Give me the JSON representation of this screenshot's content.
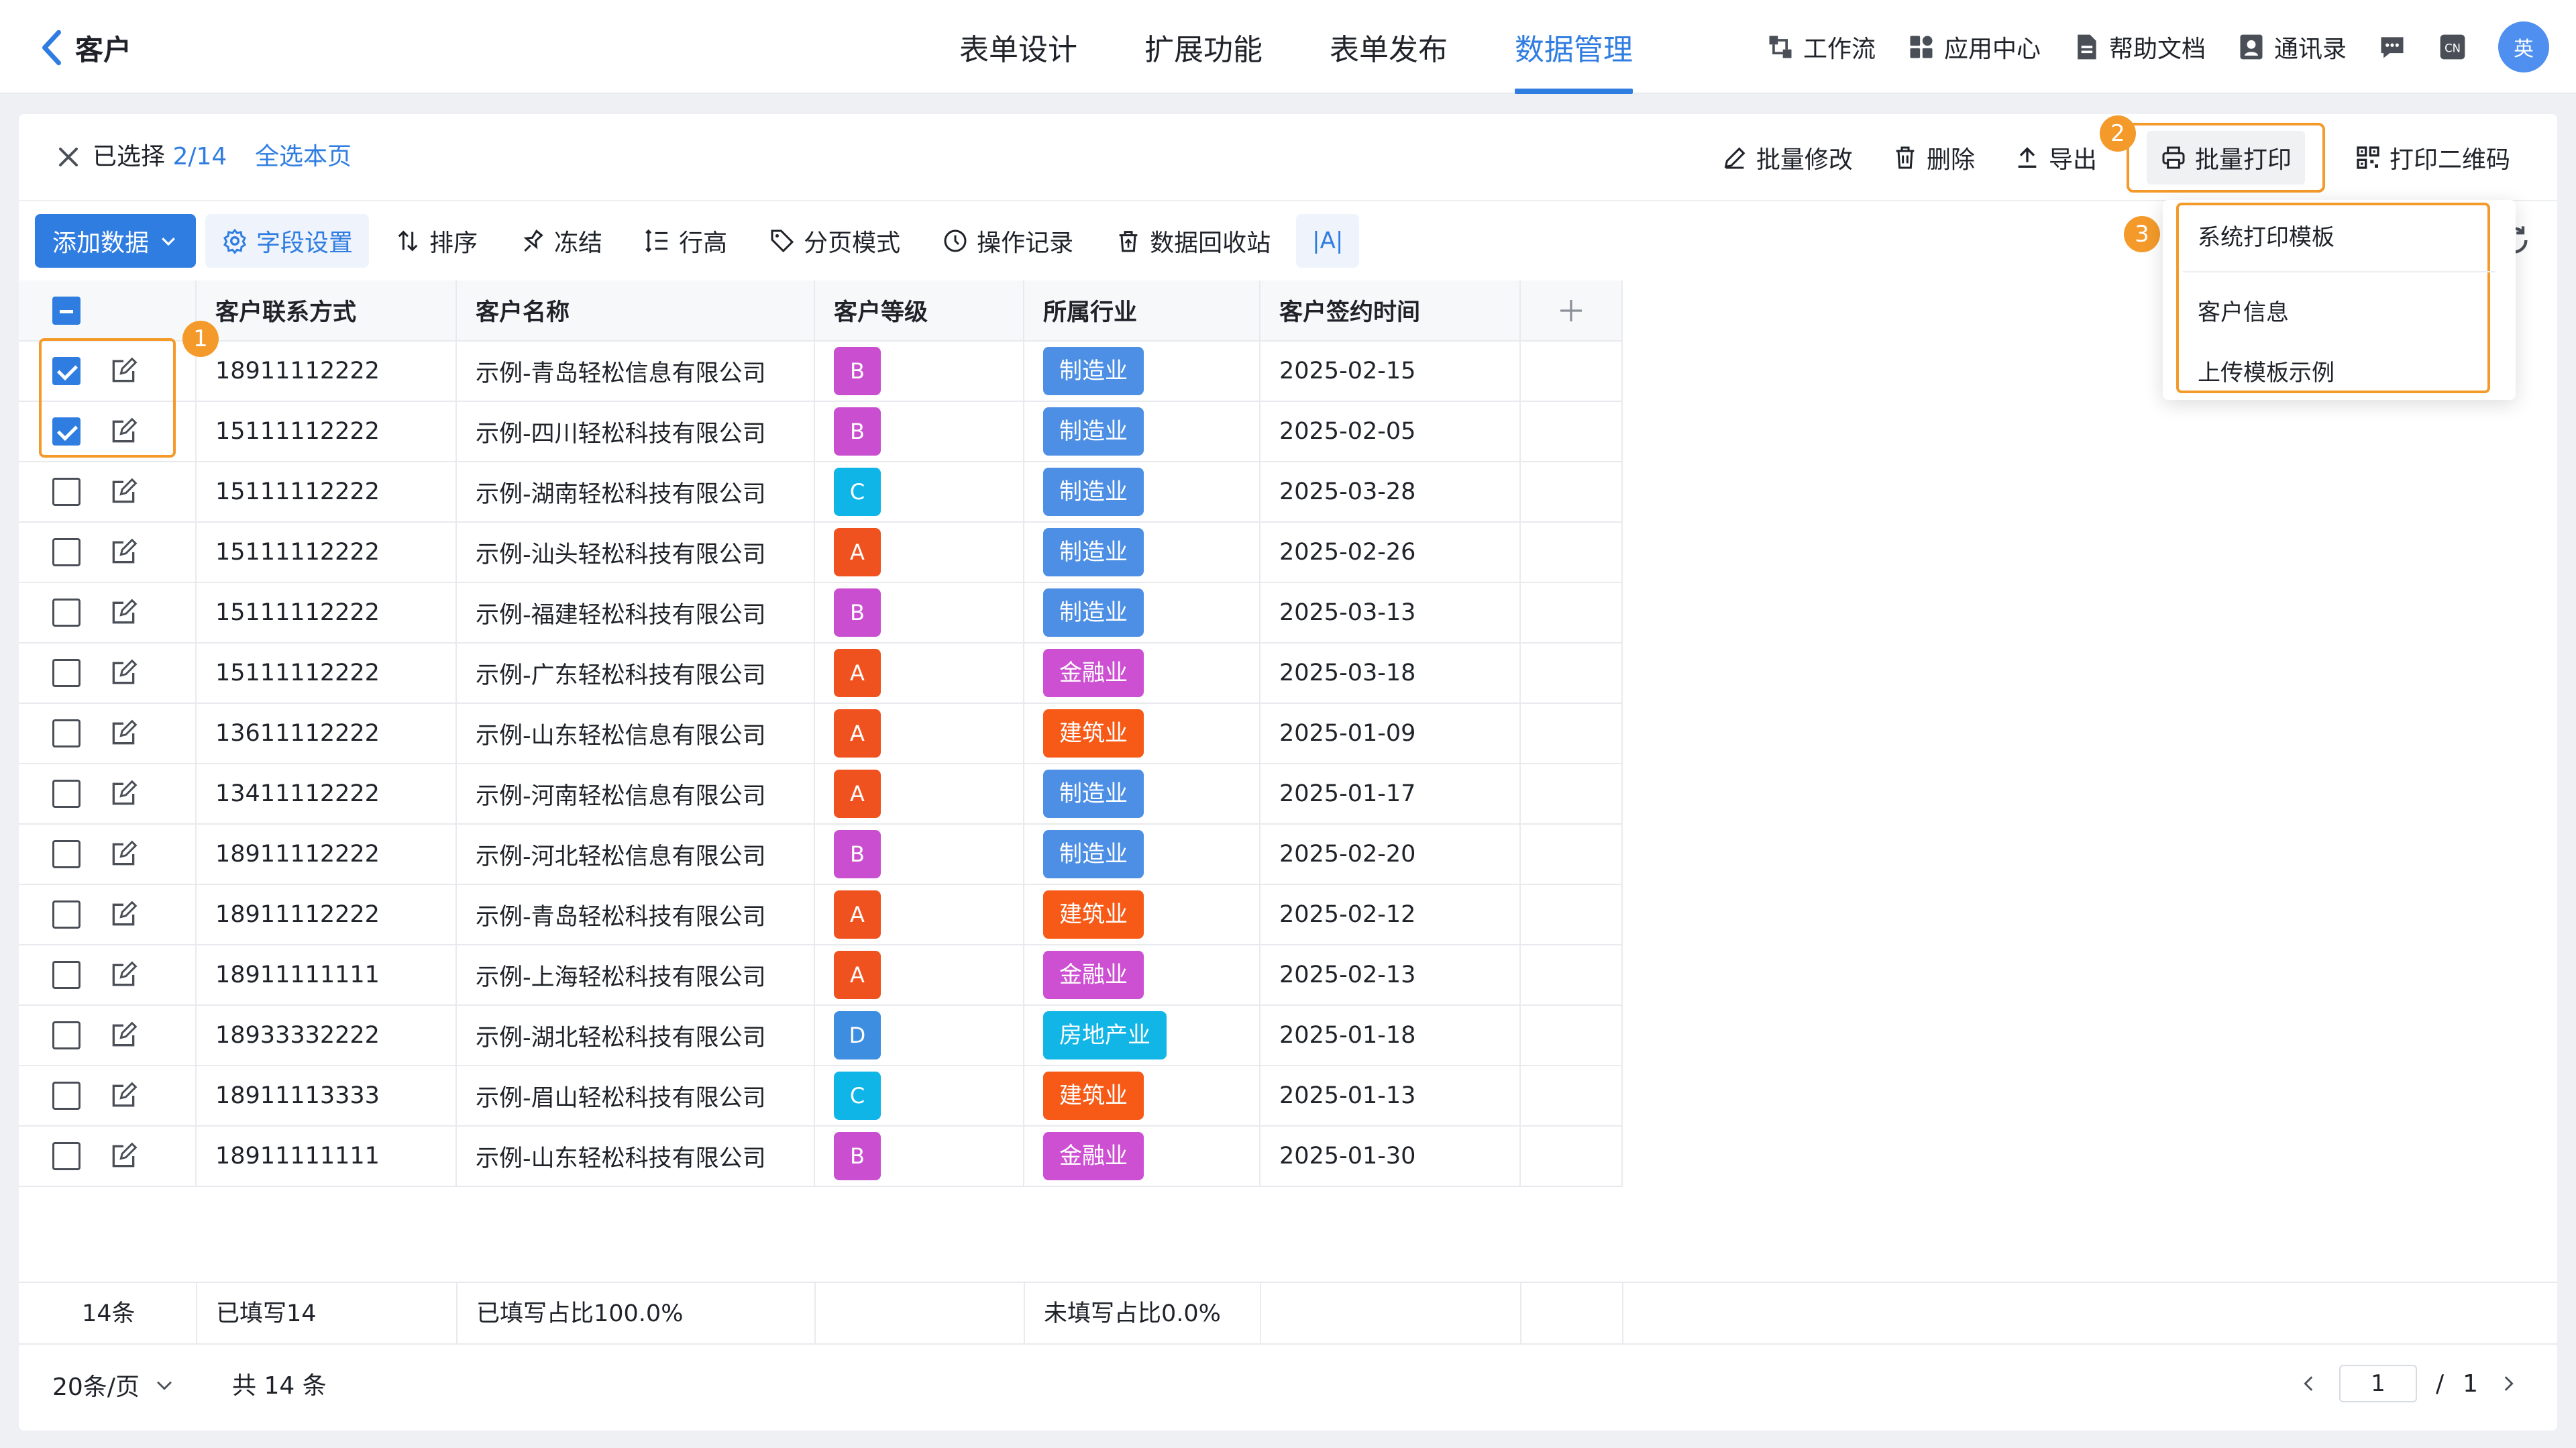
{
  "header": {
    "title": "客户",
    "tabs": [
      {
        "label": "表单设计"
      },
      {
        "label": "扩展功能"
      },
      {
        "label": "表单发布"
      },
      {
        "label": "数据管理"
      }
    ],
    "active_tab": "数据管理",
    "utils": {
      "workflow": "工作流",
      "app_center": "应用中心",
      "help_docs": "帮助文档",
      "contacts": "通讯录",
      "lang": "CN",
      "avatar": "英"
    }
  },
  "selection": {
    "prefix": "已选择 ",
    "count": "2/14",
    "select_page": "全选本页"
  },
  "actions": {
    "batch_edit": "批量修改",
    "delete": "删除",
    "export": "导出",
    "batch_print": "批量打印",
    "print_qr": "打印二维码"
  },
  "toolbar": {
    "add_data": "添加数据",
    "field_settings": "字段设置",
    "sort": "排序",
    "freeze": "冻结",
    "row_height": "行高",
    "page_mode": "分页模式",
    "op_log": "操作记录",
    "recycle": "数据回收站",
    "text_size": "|A|"
  },
  "print_menu": {
    "items": [
      "系统打印模板",
      "客户信息",
      "上传模板示例"
    ]
  },
  "markers": [
    "1",
    "2",
    "3"
  ],
  "table": {
    "columns": [
      "客户联系方式",
      "客户名称",
      "客户等级",
      "所属行业",
      "客户签约时间"
    ],
    "rows": [
      {
        "checked": true,
        "phone": "18911112222",
        "name": "示例-青岛轻松信息有限公司",
        "level": "B",
        "industry": "制造业",
        "date": "2025-02-15"
      },
      {
        "checked": true,
        "phone": "15111112222",
        "name": "示例-四川轻松科技有限公司",
        "level": "B",
        "industry": "制造业",
        "date": "2025-02-05"
      },
      {
        "checked": false,
        "phone": "15111112222",
        "name": "示例-湖南轻松科技有限公司",
        "level": "C",
        "industry": "制造业",
        "date": "2025-03-28"
      },
      {
        "checked": false,
        "phone": "15111112222",
        "name": "示例-汕头轻松科技有限公司",
        "level": "A",
        "industry": "制造业",
        "date": "2025-02-26"
      },
      {
        "checked": false,
        "phone": "15111112222",
        "name": "示例-福建轻松科技有限公司",
        "level": "B",
        "industry": "制造业",
        "date": "2025-03-13"
      },
      {
        "checked": false,
        "phone": "15111112222",
        "name": "示例-广东轻松科技有限公司",
        "level": "A",
        "industry": "金融业",
        "date": "2025-03-18"
      },
      {
        "checked": false,
        "phone": "13611112222",
        "name": "示例-山东轻松信息有限公司",
        "level": "A",
        "industry": "建筑业",
        "date": "2025-01-09"
      },
      {
        "checked": false,
        "phone": "13411112222",
        "name": "示例-河南轻松信息有限公司",
        "level": "A",
        "industry": "制造业",
        "date": "2025-01-17"
      },
      {
        "checked": false,
        "phone": "18911112222",
        "name": "示例-河北轻松信息有限公司",
        "level": "B",
        "industry": "制造业",
        "date": "2025-02-20"
      },
      {
        "checked": false,
        "phone": "18911112222",
        "name": "示例-青岛轻松科技有限公司",
        "level": "A",
        "industry": "建筑业",
        "date": "2025-02-12"
      },
      {
        "checked": false,
        "phone": "18911111111",
        "name": "示例-上海轻松科技有限公司",
        "level": "A",
        "industry": "金融业",
        "date": "2025-02-13"
      },
      {
        "checked": false,
        "phone": "18933332222",
        "name": "示例-湖北轻松科技有限公司",
        "level": "D",
        "industry": "房地产业",
        "date": "2025-01-18"
      },
      {
        "checked": false,
        "phone": "18911113333",
        "name": "示例-眉山轻松科技有限公司",
        "level": "C",
        "industry": "建筑业",
        "date": "2025-01-13"
      },
      {
        "checked": false,
        "phone": "18911111111",
        "name": "示例-山东轻松科技有限公司",
        "level": "B",
        "industry": "金融业",
        "date": "2025-01-30"
      }
    ]
  },
  "level_colors": {
    "A": "#f0521f",
    "B": "#c94fd0",
    "C": "#10b5e8",
    "D": "#3d8de0"
  },
  "industry_colors": {
    "制造业": "#4d8fe4",
    "金融业": "#cd4fd2",
    "建筑业": "#f65a16",
    "房地产业": "#12b6e6"
  },
  "summary": {
    "count": "14条",
    "filled": "已填写14",
    "fill_ratio": "已填写占比100.0%",
    "unfilled_ratio": "未填写占比0.0%"
  },
  "footer": {
    "page_size": "20条/页",
    "total": "共 14 条",
    "current_page": "1",
    "separator": "/",
    "total_pages": "1"
  }
}
